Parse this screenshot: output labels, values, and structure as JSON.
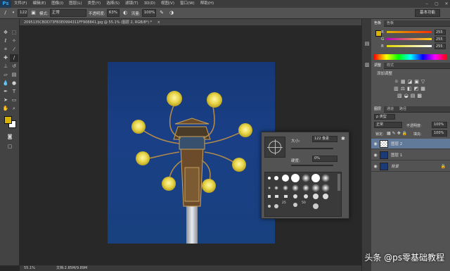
{
  "menubar": {
    "logo": "Ps",
    "items": [
      "文件(F)",
      "编辑(E)",
      "图像(I)",
      "图层(L)",
      "类型(Y)",
      "选择(S)",
      "滤镜(T)",
      "3D(D)",
      "视图(V)",
      "窗口(W)",
      "帮助(H)"
    ],
    "controls": [
      "‒",
      "▢",
      "✕"
    ]
  },
  "options": {
    "brush_size": "122",
    "mode_label": "模式:",
    "mode_value": "正常",
    "opacity_label": "不透明度:",
    "opacity_value": "63%",
    "flow_label": "流量:",
    "flow_value": "100%",
    "workspace": "基本功能"
  },
  "document": {
    "tab_title": "2095135CBDD73FB3E0994311FF908841.jpg @ 55.1% (图层 2, RGB/8*) *",
    "tab_close": "×"
  },
  "status": {
    "zoom": "55.1%",
    "doc_info": "文档:2.85M/9.89M"
  },
  "brush_picker": {
    "size_label": "大小:",
    "size_value": "122 像素",
    "hardness_label": "硬度:",
    "hardness_value": "0%",
    "preset_numbers": [
      "25",
      "50"
    ]
  },
  "color_panel": {
    "tabs": [
      "色板",
      "色板"
    ],
    "r_label": "R",
    "r_value": "255",
    "g_label": "G",
    "g_value": "255",
    "b_label": "B",
    "b_value": "255",
    "foreground": "#d9b300"
  },
  "adjust_panel": {
    "tabs": [
      "调整",
      "样式"
    ],
    "title": "添加调整"
  },
  "layers_panel": {
    "tabs": [
      "图层",
      "通道",
      "路径"
    ],
    "kind_label": "ρ 类型",
    "blend_mode": "正常",
    "opacity_label": "不透明度:",
    "opacity_value": "100%",
    "lock_label": "锁定:",
    "fill_label": "填充:",
    "fill_value": "100%",
    "layers": [
      {
        "name": "图层 2",
        "selected": true
      },
      {
        "name": "图层 1",
        "selected": false
      },
      {
        "name": "背景",
        "selected": false
      }
    ]
  },
  "watermark": "头条 @ps零基础教程"
}
